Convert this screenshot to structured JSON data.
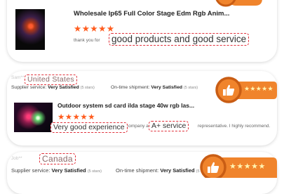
{
  "colors": {
    "accent": "#ff5c1e",
    "highlight_border": "#e0313b",
    "badge_orange": "#f0842c"
  },
  "review_1": {
    "product_title": "Wholesale Ip65 Full Color Stage Edm Rgb Anim...",
    "stars": "★★★★★",
    "comment_prefix": "thank you for",
    "highlight": "good products and good service",
    "badge_icon": "thumbs-up-icon"
  },
  "review_2": {
    "country": "United States",
    "supplier_service_label": "Supplier service:",
    "supplier_service_value": "Very Satisfied",
    "supplier_service_stars": "(5 stars)",
    "shipment_label": "On-time shipment:",
    "shipment_value": "Very Satisfied",
    "shipment_stars": "(5 stars)",
    "product_title": "Outdoor system sd card ilda stage 40w rgb las...",
    "stars": "★★★★★",
    "highlight_1": "Very good experience",
    "highlight_2": "A+ service",
    "comment_mid": "company an",
    "comment_tail": "representative. I highly recommend.",
    "badge_stars": "★★★★★",
    "badge_icon": "thumbs-up-icon"
  },
  "review_3": {
    "country": "Canada",
    "supplier_service_label": "Supplier service:",
    "supplier_service_value": "Very Satisfied",
    "supplier_service_stars": "(5 stars)",
    "shipment_label": "On-time shipment:",
    "shipment_value": "Very Satisfied",
    "shipment_stars": "(5 stars)",
    "badge_stars": "★★★★★",
    "badge_icon": "thumbs-up-icon"
  }
}
